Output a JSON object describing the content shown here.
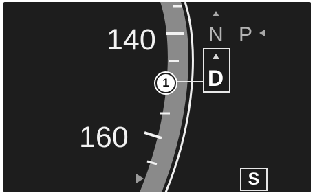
{
  "speedometer": {
    "speed_labels": [
      "140",
      "160"
    ],
    "bar_color": "#8a8a8a",
    "outline_color": "#f0f0f0",
    "tick_color": "#f2f2f2"
  },
  "transmission": {
    "gears": {
      "n": "N",
      "p": "P",
      "d": "D"
    },
    "selected_gear": "D",
    "callout_number": "1",
    "program_indicator": "S"
  },
  "icons": {
    "gear_up_n": "triangle-up-icon",
    "gear_up_d": "triangle-up-icon",
    "gear_left_p": "triangle-left-icon",
    "bottom_marker": "triangle-right-icon"
  },
  "colors": {
    "background": "#1d1d1d",
    "active_text": "#ffffff",
    "inactive_text": "#b4b4b4"
  }
}
